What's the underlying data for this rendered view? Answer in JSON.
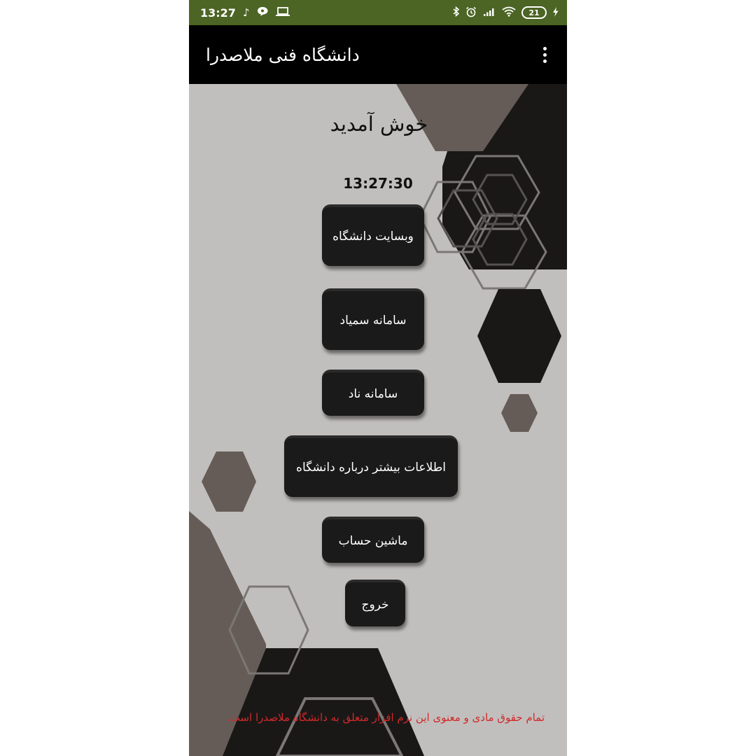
{
  "status_bar": {
    "time": "13:27",
    "left_icons": [
      "tiktok-icon",
      "chat-icon",
      "laptop-icon"
    ],
    "right_icons": [
      "bluetooth-icon",
      "alarm-icon",
      "signal-icon",
      "wifi-icon",
      "charging-icon"
    ],
    "battery": "21",
    "bar_color": "#4c6424"
  },
  "app_bar": {
    "title": "دانشگاه فنی ملاصدرا",
    "menu_icon": "overflow-menu-icon"
  },
  "main": {
    "welcome": "خوش  آمدید",
    "clock": "13:27:30",
    "buttons": [
      {
        "label": "وبسایت دانشگاه"
      },
      {
        "label": "سامانه سمیاد"
      },
      {
        "label": "سامانه ناد"
      },
      {
        "label": "اطلاعات بیشتر درباره دانشگاه"
      },
      {
        "label": "ماشین حساب"
      },
      {
        "label": "خروج"
      }
    ]
  },
  "footer": {
    "copyright": "تمام حقوق مادی و معنوی این نرم افزار متعلق به دانشگاه ملاصدرا است.",
    "color": "#d02a2a"
  },
  "colors": {
    "background": "#c1bfbd",
    "dark_shape": "#1a1817",
    "taupe_shape": "#665c57",
    "button": "#1a1a1a"
  }
}
